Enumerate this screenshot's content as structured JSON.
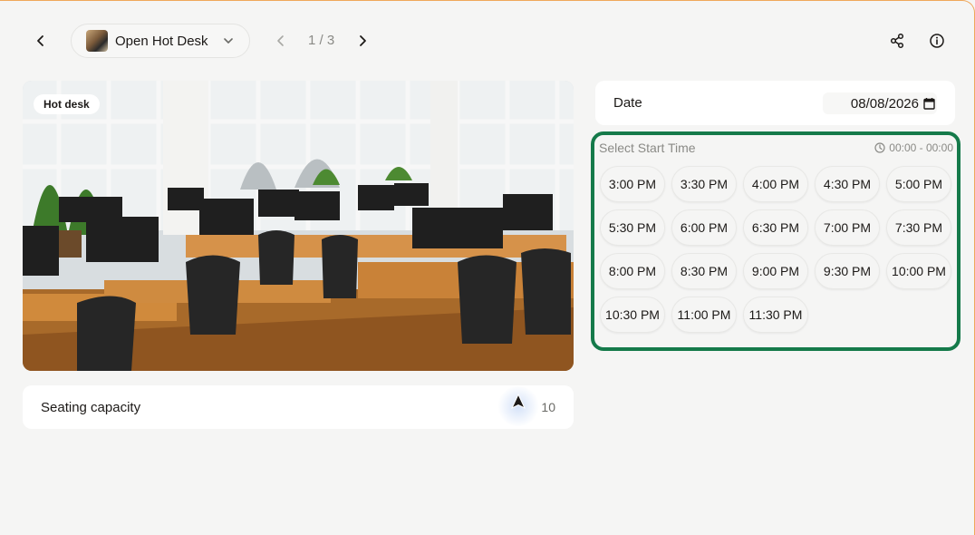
{
  "header": {
    "back_icon": "chevron-left-icon",
    "space_name": "Open Hot Desk",
    "space_dropdown_icon": "chevron-down-icon",
    "pager_text": "1 / 3",
    "share_icon": "share-icon",
    "info_icon": "info-icon"
  },
  "photo": {
    "badge": "Hot desk",
    "description_icon": "office-photo"
  },
  "capacity": {
    "label": "Seating capacity",
    "value": "10"
  },
  "date": {
    "label": "Date",
    "value": "08/08/2026",
    "calendar_icon": "calendar-icon"
  },
  "time_picker": {
    "title": "Select Start Time",
    "range": "00:00 - 00:00",
    "range_icon": "clock-icon",
    "highlight_color": "#157a4a",
    "slots": [
      "3:00 PM",
      "3:30 PM",
      "4:00 PM",
      "4:30 PM",
      "5:00 PM",
      "5:30 PM",
      "6:00 PM",
      "6:30 PM",
      "7:00 PM",
      "7:30 PM",
      "8:00 PM",
      "8:30 PM",
      "9:00 PM",
      "9:30 PM",
      "10:00 PM",
      "10:30 PM",
      "11:00 PM",
      "11:30 PM"
    ]
  },
  "colors": {
    "background": "#f5f5f4",
    "accent_border": "#f0a85a"
  }
}
